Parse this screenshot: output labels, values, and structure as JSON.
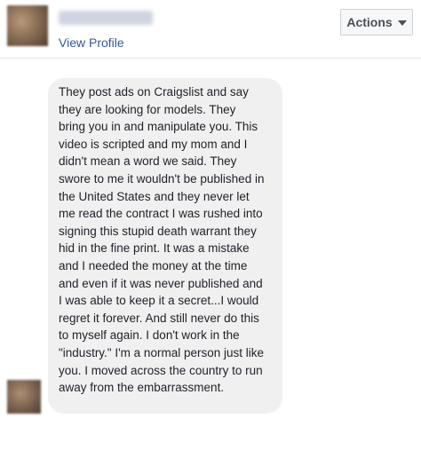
{
  "header": {
    "view_profile_label": "View Profile",
    "actions_label": "Actions"
  },
  "message": {
    "text": "They post ads on Craigslist and say\nthey are looking for models. They\nbring you in and manipulate you. This\nvideo is scripted and my mom and I\ndidn't mean a word we said. They\nswore to me it wouldn't be published in\nthe United States and they never let\nme read the contract I was rushed into\nsigning this stupid death warrant they\nhid in the fine print.  It was a mistake\nand I needed the money at the time\nand even if it was never published and\nI was able to keep it a secret...I would\nregret it forever. And still never do this\nto myself again. I don't work in the\n\"industry.\" I'm a normal person just like\nyou. I moved across the country to run\naway from the embarrassment."
  },
  "icons": {
    "actions_dropdown": "chevron-down-icon"
  },
  "colors": {
    "link": "#365899",
    "bubble": "#f1f0f0",
    "text": "#1d2129"
  }
}
